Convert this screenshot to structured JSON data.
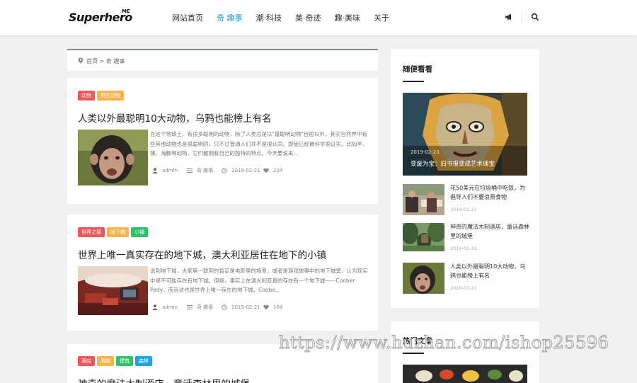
{
  "header": {
    "logo": "Superhero",
    "logo_sup": "ME",
    "nav": [
      "网站首页",
      "奇 趣事",
      "潮·科技",
      "美·奇迹",
      "趣·美味",
      "关于"
    ],
    "active_index": 1,
    "icons": [
      "megaphone-icon",
      "search-icon"
    ]
  },
  "breadcrumb": {
    "home": "首页",
    "sep": ">",
    "current": "奇 趣事",
    "icon": "location-pin-icon"
  },
  "posts": [
    {
      "tags": [
        {
          "label": "动物",
          "color": "#f0575a"
        },
        {
          "label": "野生动物",
          "color": "#f8b34a"
        }
      ],
      "title": "人类以外最聪明10大动物，乌鸦也能榜上有名",
      "excerpt": "在这个地球上，有很多聪明的动物，除了人类总是以\"最聪明动物\"自居以外，其实自然界中有些其他动物也是很聪明的，只不过普通人们并不是很认同，即使已经被科学家证实。比如羊、猪、海豚等动物，它们都拥有自己的独特的特点。今天要说来...",
      "author": "admin",
      "category": "奇 趣事",
      "date": "2019-02-21",
      "likes": "234"
    },
    {
      "tags": [
        {
          "label": "世界之最",
          "color": "#f0575a"
        },
        {
          "label": "地下城",
          "color": "#f8b34a"
        },
        {
          "label": "小镇",
          "color": "#2ec36a"
        }
      ],
      "title": "世界上唯一真实存在的地下城，澳大利亚居住在地下的小镇",
      "excerpt": "说到地下城，大家第一联到的肯定是电影里的场景，或者是游戏故事中的地下城堡，认为现实中是不可能存在有地下城。但是，事实上在澳大利亚真的存在有一个地下城——Coober Pedy，而且这也是世界上唯一存在的地下城。Coobe...",
      "author": "admin",
      "category": "奇 趣事",
      "date": "2019-02-21",
      "likes": "164"
    },
    {
      "tags": [
        {
          "label": "酒店",
          "color": "#f0575a"
        },
        {
          "label": "酒店",
          "color": "#f8b34a"
        },
        {
          "label": "建筑",
          "color": "#2ec36a"
        },
        {
          "label": "森林",
          "color": "#1ea3e6"
        }
      ],
      "title": "神奇的魔法木制酒店，童话森林里的城堡"
    }
  ],
  "sidebar": {
    "random_title": "随便看看",
    "featured": {
      "date": "2019-02-20",
      "title": "变废为宝：旧书报变成艺术瑰宝"
    },
    "random_list": [
      {
        "title": "花50美元在垃圾桶中吃饭，为倡导人们不要浪费食物",
        "date": "2019-02-21"
      },
      {
        "title": "神奇的魔法木制酒店，童话森林里的城堡",
        "date": "2019-02-21"
      },
      {
        "title": "人类以外最聪明10大动物，乌鸦也能榜上有名",
        "date": "2019-02-21"
      }
    ],
    "hot_title": "热门文章"
  },
  "watermark": "https://www.huzhan.com/ishop25596",
  "colors": {
    "accent": "#1e9be2",
    "tag_red": "#f0575a",
    "tag_orange": "#f8b34a",
    "tag_green": "#2ec36a",
    "tag_blue": "#1ea3e6"
  }
}
